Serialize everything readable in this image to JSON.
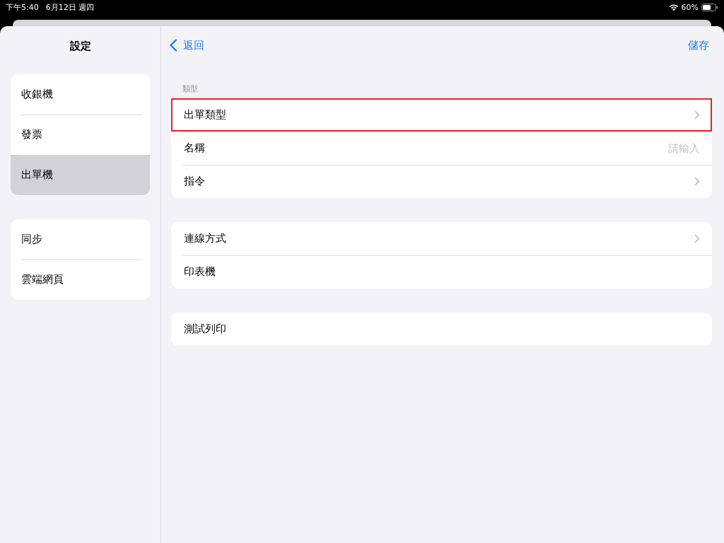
{
  "status_bar": {
    "time": "下午5:40",
    "date": "6月12日 週四",
    "battery": "60%"
  },
  "sidebar": {
    "title": "設定",
    "groups": [
      {
        "items": [
          {
            "label": "收銀機",
            "selected": false
          },
          {
            "label": "發票",
            "selected": false
          },
          {
            "label": "出單機",
            "selected": true
          }
        ]
      },
      {
        "items": [
          {
            "label": "同步",
            "selected": false
          },
          {
            "label": "雲端網頁",
            "selected": false
          }
        ]
      }
    ]
  },
  "detail": {
    "back": "返回",
    "save": "儲存",
    "sections": [
      {
        "header": "類型",
        "rows": [
          {
            "kind": "nav",
            "label": "出單類型",
            "highlighted": true
          },
          {
            "kind": "input",
            "label": "名稱",
            "placeholder": "請輸入",
            "highlighted": false
          },
          {
            "kind": "nav",
            "label": "指令",
            "highlighted": false
          }
        ]
      },
      {
        "rows": [
          {
            "kind": "nav",
            "label": "連線方式",
            "highlighted": false
          },
          {
            "kind": "plain",
            "label": "印表機",
            "highlighted": false
          }
        ]
      },
      {
        "rows": [
          {
            "kind": "plain",
            "label": "測試列印",
            "highlighted": false
          }
        ]
      }
    ]
  }
}
